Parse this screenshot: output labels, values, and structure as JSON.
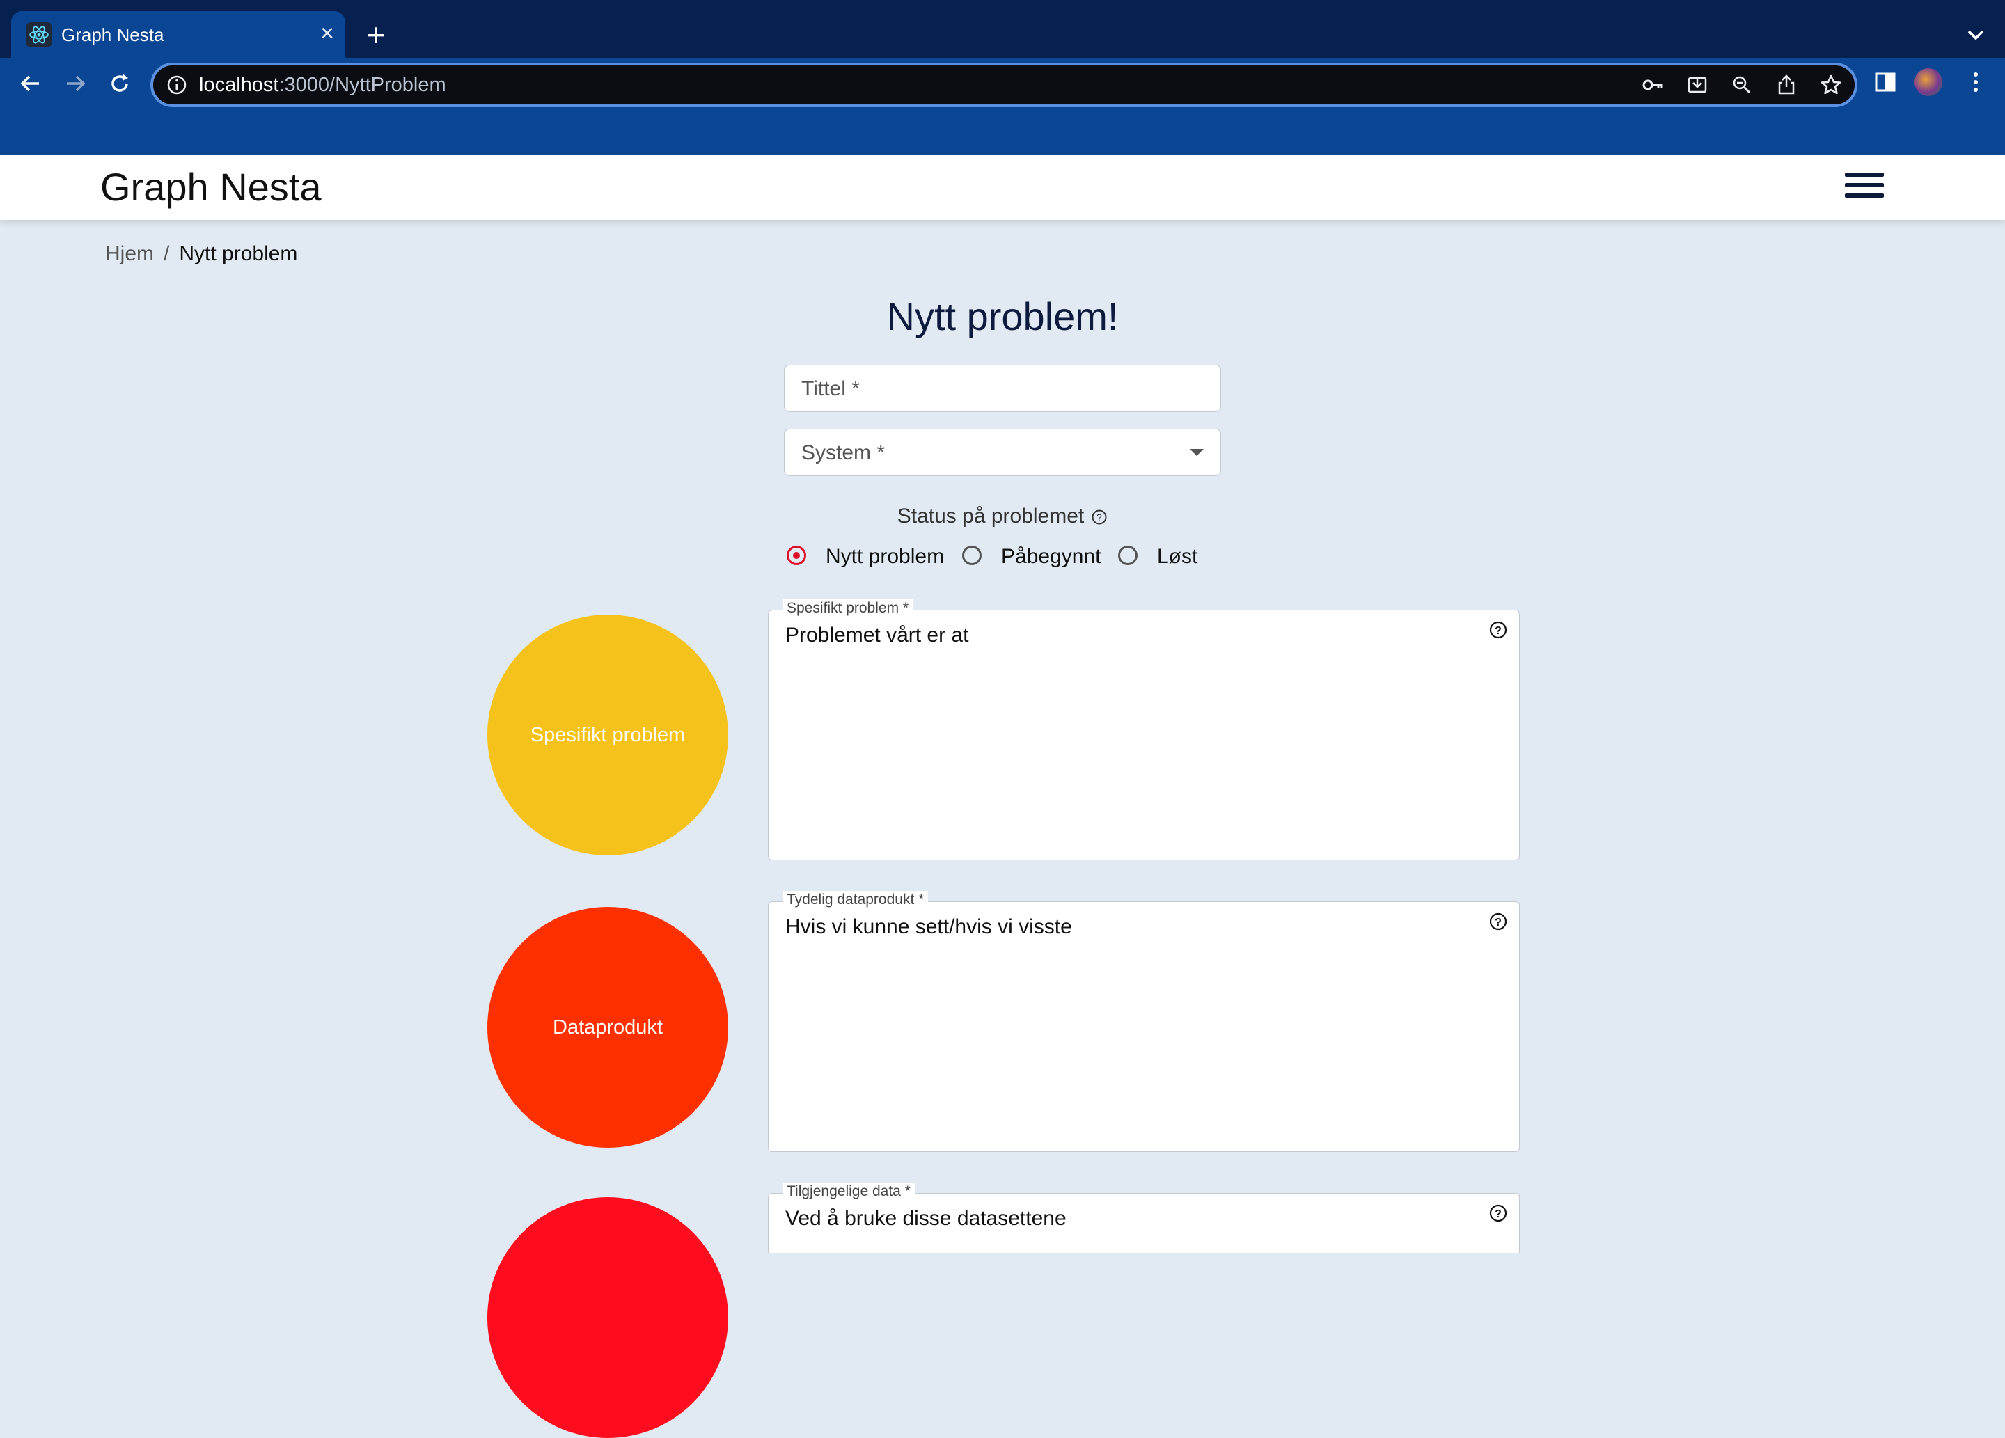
{
  "browser": {
    "tab_title": "Graph Nesta",
    "url_host": "localhost",
    "url_rest": ":3000/NyttProblem"
  },
  "app": {
    "brand": "Graph Nesta"
  },
  "breadcrumb": {
    "home": "Hjem",
    "separator": "/",
    "current": "Nytt problem"
  },
  "form": {
    "title": "Nytt problem!",
    "title_placeholder": "Tittel *",
    "system_placeholder": "System *",
    "status_label": "Status på problemet",
    "status_options": [
      {
        "label": "Nytt problem",
        "selected": true
      },
      {
        "label": "Påbegynnt",
        "selected": false
      },
      {
        "label": "Løst",
        "selected": false
      }
    ],
    "sections": [
      {
        "circle_label": "Spesifikt problem",
        "circle_color": "#f5c21b",
        "field_label": "Spesifikt problem *",
        "value": "Problemet vårt er at"
      },
      {
        "circle_label": "Dataprodukt",
        "circle_color": "#ff3000",
        "field_label": "Tydelig dataprodukt *",
        "value": "Hvis vi kunne sett/hvis vi visste"
      },
      {
        "circle_label": "",
        "circle_color": "#ff0d1f",
        "field_label": "Tilgjengelige data *",
        "value": "Ved å bruke disse datasettene"
      }
    ]
  }
}
